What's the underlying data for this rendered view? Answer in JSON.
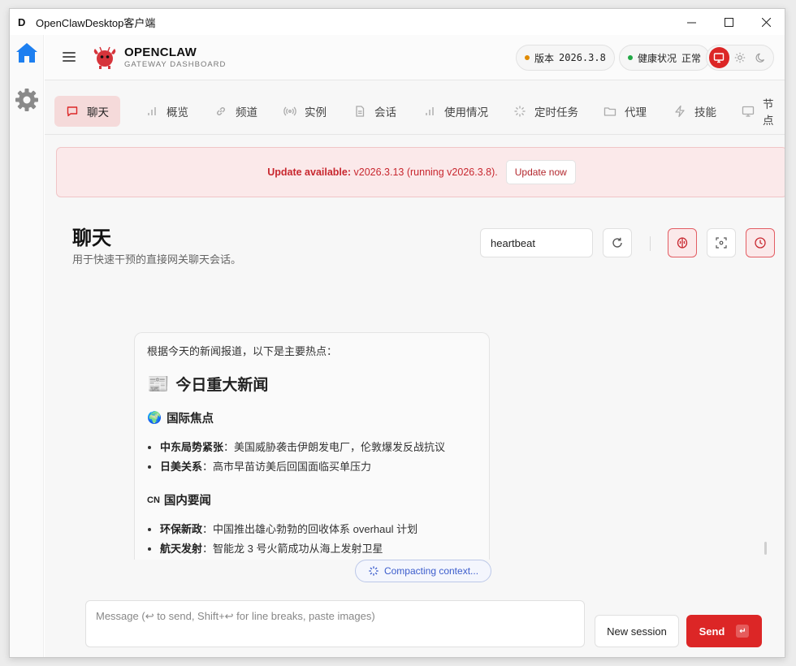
{
  "window": {
    "app_icon_letter": "D",
    "title": "OpenClawDesktop客户端",
    "minimize": "—",
    "maximize": "☐",
    "close": "✕"
  },
  "sidebar": {
    "items": [
      {
        "icon": "home-icon",
        "color": "#1d7ff0"
      },
      {
        "icon": "gear-icon",
        "color": "#8a8a8a"
      }
    ]
  },
  "header": {
    "brand_name": "OPENCLAW",
    "brand_sub": "GATEWAY DASHBOARD",
    "version_label": "版本",
    "version_value": "2026.3.8",
    "version_dot_color": "#e08a00",
    "health_label": "健康状况",
    "health_value": "正常",
    "health_dot_color": "#21a845",
    "theme_options": [
      "monitor-icon",
      "sun-icon",
      "moon-icon"
    ],
    "theme_active": "monitor-icon"
  },
  "tabs": [
    {
      "label": "聊天",
      "icon": "chat-icon",
      "active": true
    },
    {
      "label": "概览",
      "icon": "bar-chart-icon",
      "active": false
    },
    {
      "label": "频道",
      "icon": "link-icon",
      "active": false
    },
    {
      "label": "实例",
      "icon": "broadcast-icon",
      "active": false
    },
    {
      "label": "会话",
      "icon": "document-icon",
      "active": false
    },
    {
      "label": "使用情况",
      "icon": "bar-chart-icon",
      "active": false
    },
    {
      "label": "定时任务",
      "icon": "loader-icon",
      "active": false
    },
    {
      "label": "代理",
      "icon": "folder-icon",
      "active": false
    },
    {
      "label": "技能",
      "icon": "zap-icon",
      "active": false
    },
    {
      "label": "节点",
      "icon": "monitor-icon",
      "active": false
    }
  ],
  "banner": {
    "prefix": "Update available:",
    "message": "v2026.3.13 (running v2026.3.8).",
    "button_label": "Update now"
  },
  "page": {
    "title": "聊天",
    "subtitle": "用于快速干预的直接网关聊天会话。",
    "session_value": "heartbeat"
  },
  "chat": {
    "intro": "根据今天的新闻报道，以下是主要热点：",
    "heading_emoji": "📰",
    "heading": "今日重大新闻",
    "section1_emoji": "🌍",
    "section1_title": "国际焦点",
    "section1_items": [
      {
        "bold": "中东局势紧张",
        "text": "：美国威胁袭击伊朗发电厂，伦敦爆发反战抗议"
      },
      {
        "bold": "日美关系",
        "text": "：高市早苗访美后回国面临买单压力"
      }
    ],
    "section2_emoji": "CN",
    "section2_title": "国内要闻",
    "section2_items": [
      {
        "bold": "环保新政",
        "text": "：中国推出雄心勃勃的回收体系 overhaul 计划"
      },
      {
        "bold": "航天发射",
        "text": "：智能龙 3 号火箭成功从海上发射卫星"
      }
    ]
  },
  "status": {
    "compacting": "Compacting context..."
  },
  "composer": {
    "placeholder": "Message (↩ to send, Shift+↩ for line breaks, paste images)",
    "new_session_label": "New session",
    "send_label": "Send",
    "send_kbd": "↵"
  }
}
